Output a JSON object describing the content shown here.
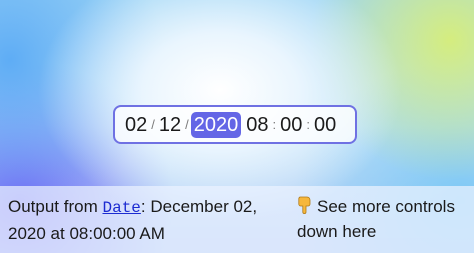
{
  "datetime": {
    "month": "02",
    "day": "12",
    "year": "2020",
    "hour": "08",
    "minute": "00",
    "second": "00",
    "date_separator": "/",
    "time_separator": ":",
    "focused_segment": "year"
  },
  "output": {
    "prefix": "Output from ",
    "link_text": "Date",
    "value": ": December 02, 2020 at 08:00:00 AM"
  },
  "more_controls": {
    "icon": "pointing-down-hand-icon",
    "text": "See more controls down here"
  },
  "colors": {
    "accent": "#6466e6",
    "border": "#6f71e3",
    "link": "#1c2bd1"
  }
}
